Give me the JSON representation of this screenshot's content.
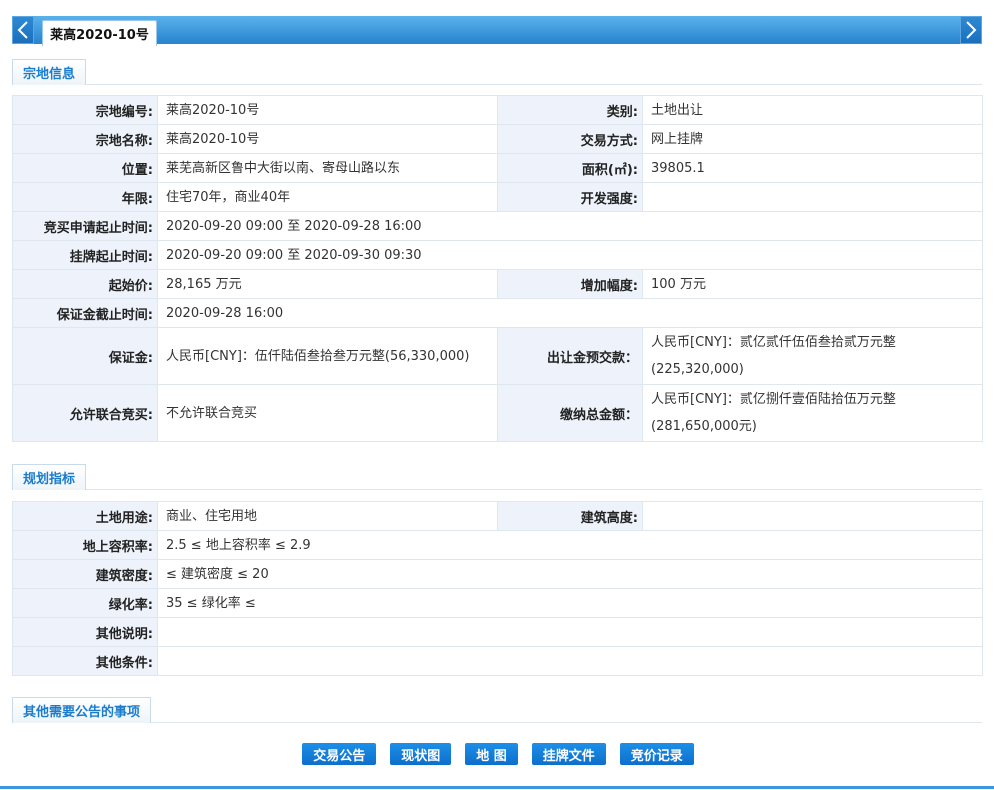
{
  "tab": {
    "title": "莱高2020-10号"
  },
  "nav": {
    "prev_icon": "chevron-left-icon",
    "next_icon": "chevron-right-icon"
  },
  "sections": {
    "parcel_info": "宗地信息",
    "planning": "规划指标",
    "other": "其他需要公告的事项"
  },
  "parcel": {
    "rows": [
      {
        "k1": "宗地编号:",
        "v1": "莱高2020-10号",
        "k2": "类别:",
        "v2": "土地出让"
      },
      {
        "k1": "宗地名称:",
        "v1": "莱高2020-10号",
        "k2": "交易方式:",
        "v2": "网上挂牌"
      },
      {
        "k1": "位置:",
        "v1": "莱芜高新区鲁中大街以南、寄母山路以东",
        "k2": "面积(㎡):",
        "v2": "39805.1"
      },
      {
        "k1": "年限:",
        "v1": "住宅70年，商业40年",
        "k2": "开发强度:",
        "v2": ""
      }
    ],
    "bid_apply_time_label": "竞买申请起止时间:",
    "bid_apply_time": "2020-09-20 09:00 至 2020-09-28 16:00",
    "listing_time_label": "挂牌起止时间:",
    "listing_time": "2020-09-20 09:00 至 2020-09-30 09:30",
    "start_price_label": "起始价:",
    "start_price": "28,165 万元",
    "increment_label": "增加幅度:",
    "increment": "100 万元",
    "deposit_deadline_label": "保证金截止时间:",
    "deposit_deadline": "2020-09-28 16:00",
    "deposit_label": "保证金:",
    "deposit": "人民币[CNY]：伍仟陆佰叁拾叁万元整(56,330,000)",
    "prepay_label": "出让金预交款：",
    "prepay": "人民币[CNY]：贰亿贰仟伍佰叁拾贰万元整(225,320,000)",
    "joint_label": "允许联合竞买:",
    "joint": "不允许联合竞买",
    "total_label": "缴纳总金额：",
    "total": "人民币[CNY]：贰亿捌仟壹佰陆拾伍万元整(281,650,000元)"
  },
  "planning": {
    "land_use_label": "土地用途:",
    "land_use": "商业、住宅用地",
    "height_label": "建筑高度:",
    "height": "",
    "far_label": "地上容积率:",
    "far": "2.5 ≤ 地上容积率 ≤ 2.9",
    "density_label": "建筑密度:",
    "density": "≤ 建筑密度 ≤ 20",
    "green_label": "绿化率:",
    "green": "35 ≤ 绿化率 ≤",
    "other_note_label": "其他说明:",
    "other_note": "",
    "other_cond_label": "其他条件:",
    "other_cond": ""
  },
  "buttons": {
    "announcement": "交易公告",
    "status_map": "现状图",
    "map": "地 图",
    "listing_docs": "挂牌文件",
    "bid_records": "竞价记录"
  },
  "colors": {
    "accent": "#1a7ccd",
    "button": "#0d6fcb",
    "key_bg": "#eef3fb"
  }
}
